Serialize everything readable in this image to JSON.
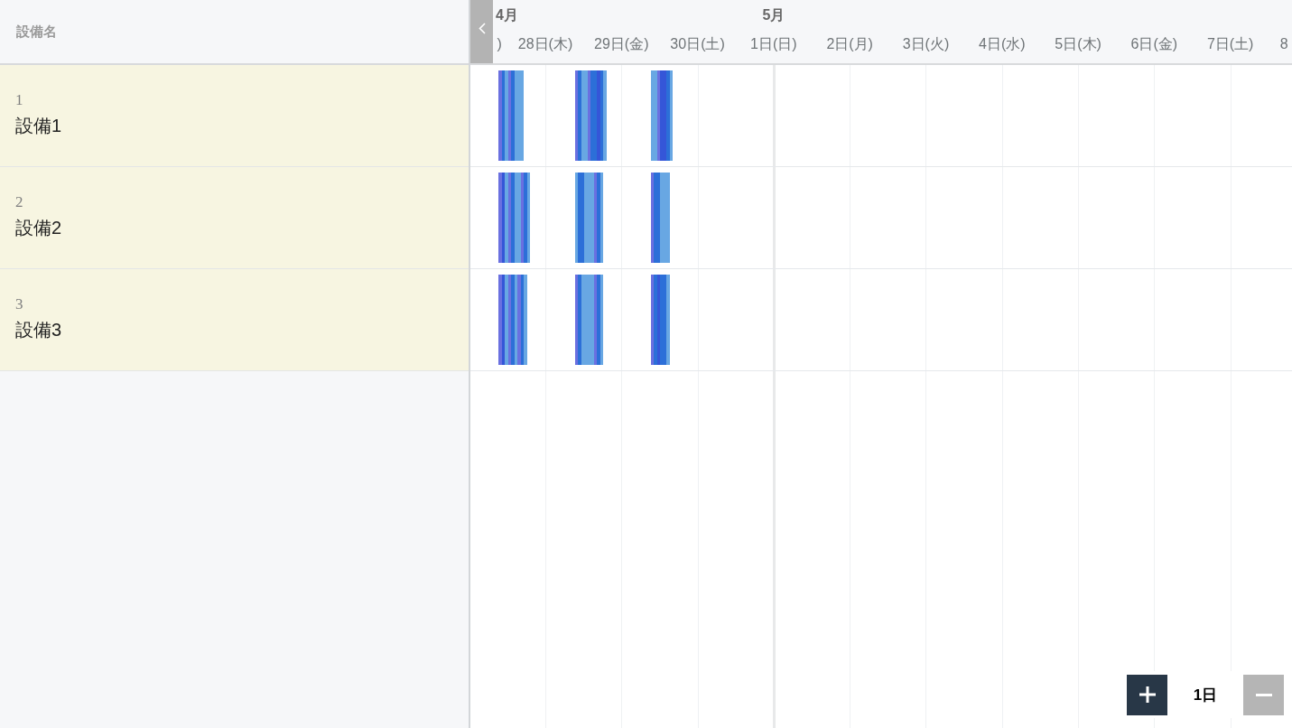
{
  "resource_panel": {
    "header": "設備名"
  },
  "timeline": {
    "months": [
      {
        "label": "4月",
        "days": [
          ")",
          "28日(木)",
          "29日(金)",
          "30日(土)"
        ]
      },
      {
        "label": "5月",
        "days": [
          "1日(日)",
          "2日(月)",
          "3日(火)",
          "4日(水)",
          "5日(木)",
          "6日(金)",
          "7日(土)",
          "8"
        ]
      }
    ]
  },
  "equipment": [
    {
      "number": "1",
      "name": "設備1",
      "bookings": [
        {
          "slots": [
            {
              "color": "#6a70e0"
            },
            {
              "color": "#2c6fd8"
            },
            {
              "color": "#68a7e3"
            },
            {
              "color": "#6a70e0"
            },
            {
              "color": "#2c6fd8"
            },
            {
              "color": "#68a7e3"
            },
            {
              "color": "#68a7e3"
            },
            {
              "color": "#68a7e3"
            }
          ]
        },
        {
          "slots": [
            {
              "color": "#6a70e0"
            },
            {
              "color": "#2c6fd8"
            },
            {
              "color": "#68a7e3"
            },
            {
              "color": "#68a7e3"
            },
            {
              "color": "#6a70e0"
            },
            {
              "color": "#2c6fd8"
            },
            {
              "color": "#2c6fd8"
            },
            {
              "color": "#3556d8"
            },
            {
              "color": "#2c6fd8"
            },
            {
              "color": "#68a7e3"
            }
          ]
        },
        {
          "slots": [
            {
              "color": "#68a7e3"
            },
            {
              "color": "#68a7e3"
            },
            {
              "color": "#6a70e0"
            },
            {
              "color": "#3556d8"
            },
            {
              "color": "#3556d8"
            },
            {
              "color": "#2c6fd8"
            },
            {
              "color": "#68a7e3"
            }
          ]
        }
      ]
    },
    {
      "number": "2",
      "name": "設備2",
      "bookings": [
        {
          "slots": [
            {
              "color": "#6a70e0"
            },
            {
              "color": "#3556d8"
            },
            {
              "color": "#68a7e3"
            },
            {
              "color": "#6a70e0"
            },
            {
              "color": "#2c6fd8"
            },
            {
              "color": "#68a7e3"
            },
            {
              "color": "#68a7e3"
            },
            {
              "color": "#6a70e0"
            },
            {
              "color": "#2c6fd8"
            },
            {
              "color": "#68a7e3"
            }
          ]
        },
        {
          "slots": [
            {
              "color": "#68a7e3"
            },
            {
              "color": "#2c6fd8"
            },
            {
              "color": "#2c6fd8"
            },
            {
              "color": "#68a7e3"
            },
            {
              "color": "#68a7e3"
            },
            {
              "color": "#68a7e3"
            },
            {
              "color": "#6a70e0"
            },
            {
              "color": "#2c6fd8"
            },
            {
              "color": "#68a7e3"
            }
          ]
        },
        {
          "slots": [
            {
              "color": "#6a70e0"
            },
            {
              "color": "#2c6fd8"
            },
            {
              "color": "#2c6fd8"
            },
            {
              "color": "#68a7e3"
            },
            {
              "color": "#68a7e3"
            },
            {
              "color": "#68a7e3"
            }
          ]
        }
      ]
    },
    {
      "number": "3",
      "name": "設備3",
      "bookings": [
        {
          "slots": [
            {
              "color": "#6a70e0"
            },
            {
              "color": "#3556d8"
            },
            {
              "color": "#68a7e3"
            },
            {
              "color": "#6a70e0"
            },
            {
              "color": "#2c6fd8"
            },
            {
              "color": "#68a7e3"
            },
            {
              "color": "#6a70e0"
            },
            {
              "color": "#2c6fd8"
            },
            {
              "color": "#68a7e3"
            }
          ]
        },
        {
          "slots": [
            {
              "color": "#6a70e0"
            },
            {
              "color": "#2c6fd8"
            },
            {
              "color": "#68a7e3"
            },
            {
              "color": "#68a7e3"
            },
            {
              "color": "#68a7e3"
            },
            {
              "color": "#68a7e3"
            },
            {
              "color": "#6a70e0"
            },
            {
              "color": "#2c6fd8"
            },
            {
              "color": "#68a7e3"
            }
          ]
        },
        {
          "slots": [
            {
              "color": "#6a70e0"
            },
            {
              "color": "#2c6fd8"
            },
            {
              "color": "#3556d8"
            },
            {
              "color": "#2c6fd8"
            },
            {
              "color": "#2c6fd8"
            },
            {
              "color": "#68a7e3"
            }
          ]
        }
      ]
    }
  ],
  "zoom_control": {
    "buttons": [
      {
        "kind": "zoom_in",
        "disabled": false
      },
      {
        "kind": "zoom_out",
        "disabled": true
      }
    ],
    "level": "1日"
  }
}
